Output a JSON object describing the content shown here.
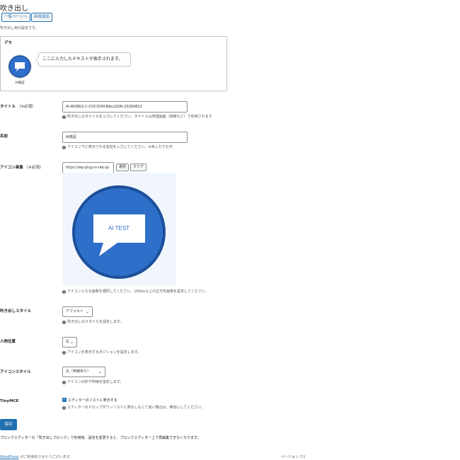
{
  "page": {
    "title": "吹き出し",
    "list_button": "一覧ページへ",
    "new_button": "新規追加",
    "description": "吹き出し用の設定です。"
  },
  "demo": {
    "label": "デモ",
    "name": "AI検証",
    "bubble_text": "ここに入力したテキストが表示されます。"
  },
  "title_field": {
    "label": "タイトル",
    "required": "（※必須）",
    "value": "AI-WORK2-C-COCOON-BALLOON-20260822",
    "hint": "吹き出しのタイトルを入力してください。タイトルは管理画面（検索など）で利用されます"
  },
  "name_field": {
    "label": "名前",
    "value": "AI検証",
    "hint": "アイコン下に表示される名前を入力してください。※未入力でも可"
  },
  "icon_field": {
    "label": "アイコン画像",
    "required": "（※必須）",
    "value": "https://wp-plug-in-lab.sp",
    "select_button": "選択",
    "clear_button": "クリア",
    "image_text": "AI TEST",
    "hint": "アイコンとなる画像を選択してください。160px以上の正方形画像を設定してください。"
  },
  "style_field": {
    "label": "吹き出しスタイル",
    "selected": "デフォルト",
    "hint": "吹き出しのスタイルを設定します。"
  },
  "position_field": {
    "label": "人物位置",
    "selected": "左",
    "hint": "アイコンを表示するポジションを設定します。"
  },
  "icon_style_field": {
    "label": "アイコンスタイル",
    "selected": "丸（枠線あり）",
    "hint": "アイコンの形や枠線を指定します。"
  },
  "tinymce_field": {
    "label": "TinyMCE",
    "checkbox_label": "エディターのリストに表示する",
    "hint": "エディターのドロップダウンリストに表示しなくて良い場合は、無効にしてください。"
  },
  "save_button": "保存",
  "footer_note": "ブロックエディターの「吹き出しブロック」で利用後、設定を変更すると、ブロックエディター上で再編集できなくなります。",
  "footer": {
    "wp_link": "WordPress",
    "thanks": " のご利用ありがとうございます。",
    "version": "バージョン 7.1"
  },
  "colors": {
    "accent": "#2271b1",
    "icon_blue": "#2e6fc9",
    "icon_ring": "#1d4f9a"
  }
}
